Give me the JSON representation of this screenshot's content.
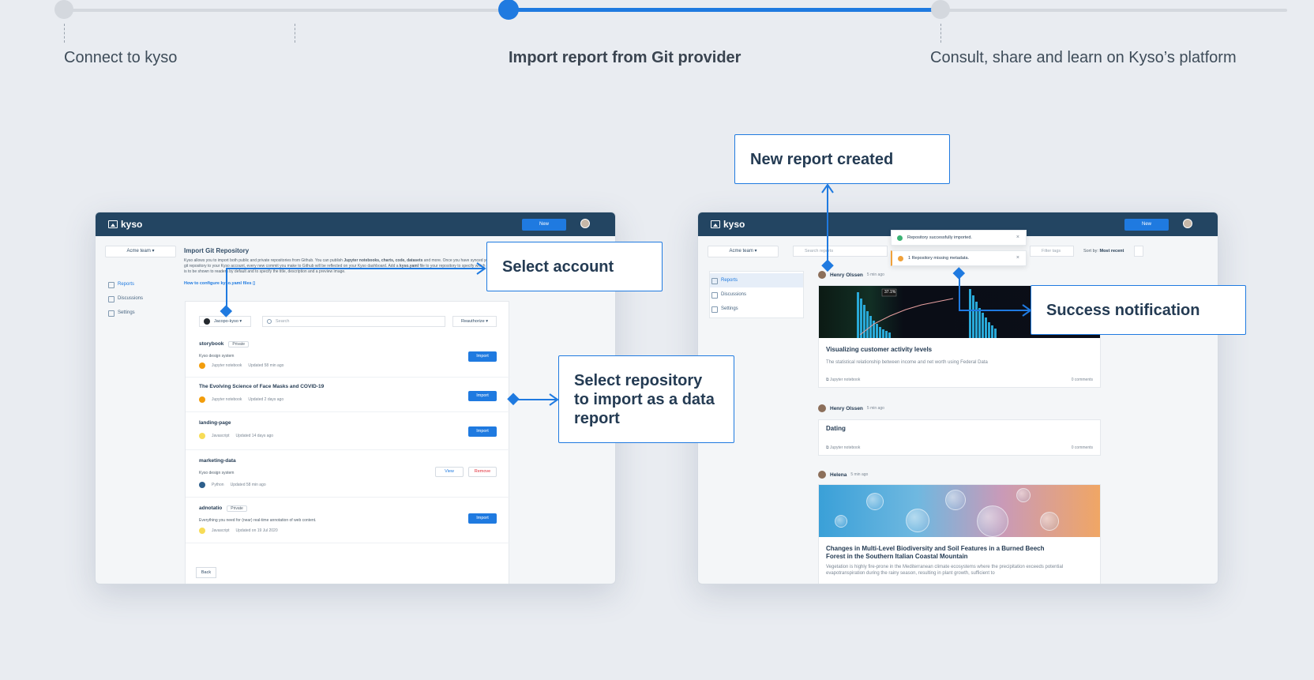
{
  "steps": [
    {
      "label": "Connect to kyso"
    },
    {
      "label": "Import report from Git provider"
    },
    {
      "label": "Consult, share and learn on Kyso’s platform"
    }
  ],
  "callouts": {
    "select_account": "Select account",
    "select_repository": "Select repository to import as a data report",
    "new_report": "New report created",
    "success_notification": "Success notification"
  },
  "left_app": {
    "logo": "kyso",
    "new_button": "New",
    "team": "Acme team",
    "nav": [
      "Reports",
      "Discussions",
      "Settings"
    ],
    "import_title": "Import Git Repository",
    "import_desc_1": "Kyso allows you to import both public and private repositories from Github.  You can publish ",
    "import_desc_bold_1": "Jupyter notebooks, charts, code, datasets",
    "import_desc_2": " and more. Once you have synced your git repository to your Kyso account, every new commit you make to Github will be reflected on your Kyso dashboard. Add a ",
    "import_desc_bold_2": "kyso.yaml",
    "import_desc_3": " file to your repository to specify which file is to be shown to readers by default and to specify the title, description and a preview image.",
    "config_link": "How to configure kyso.yaml files",
    "account": "Jacopo-kyso",
    "search_placeholder": "Search",
    "reauthorize": "Reauthorize",
    "repos": [
      {
        "name": "storybook",
        "badge": "Private",
        "sub": "Kyso design system",
        "lang": "Jupyter notebook",
        "updated": "Updated 58 min ago",
        "action": "Import",
        "dot": "#f29d0c"
      },
      {
        "name": "The Evolving Science of Face Masks and COVID-19",
        "badge": "",
        "sub": "",
        "lang": "Jupyter notebook",
        "updated": "Updated 2 days ago",
        "action": "Import",
        "dot": "#f29d0c"
      },
      {
        "name": "landing-page",
        "badge": "",
        "sub": "",
        "lang": "Javascript",
        "updated": "Updated 14 days ago",
        "action": "Import",
        "dot": "#f7dc57"
      },
      {
        "name": "marketing-data",
        "badge": "",
        "sub": "Kyso design system",
        "lang": "Python",
        "updated": "Updated 58 min ago",
        "view": "View",
        "remove": "Remove",
        "dot": "#2e5f8c"
      },
      {
        "name": "adnotatio",
        "badge": "Private",
        "sub": "Everything you need for (near) real-time annotation of web content.",
        "lang": "Javascript",
        "updated": "Updated on 19 Jul 2020",
        "action": "Import",
        "dot": "#f7dc57"
      }
    ],
    "back": "Back"
  },
  "right_app": {
    "logo": "kyso",
    "new_button": "New",
    "team": "Acme team",
    "nav": [
      "Reports",
      "Discussions",
      "Settings"
    ],
    "search_placeholder": "Search reports",
    "filter_placeholder": "Filter tags",
    "sort_label": "Sort by: ",
    "sort_value": "Most recent",
    "toast_success": "Repository successfully imported.",
    "toast_warning": "1 Repository missing metadata.",
    "chart_label": "37.1%",
    "posts": [
      {
        "author": "Henry Olssen",
        "time": "5 min ago",
        "title": "Visualizing customer activity levels",
        "desc": "The statistical relationship between income and net worth using Federal Data",
        "lang": "Jupyter notebook",
        "comments": "0 comments"
      },
      {
        "author": "Henry Olssen",
        "time": "5 min ago",
        "title": "Dating",
        "desc": "",
        "lang": "Jupyter notebook",
        "comments": "0 comments"
      },
      {
        "author": "Helena",
        "time": "5 min ago",
        "title": "Changes in Multi-Level Biodiversity and Soil Features in a Burned Beech Forest in the Southern Italian Coastal Mountain",
        "desc": "Vegetation is highly fire-prone in the Mediterranean climate ecosystems where the precipitation exceeds potential evapotranspiration during the rainy season, resulting in plant growth, sufficient to"
      }
    ]
  },
  "colors": {
    "accent": "#1f7ae0",
    "navbar": "#234562",
    "warning": "#f0a13a",
    "success": "#3bb273"
  }
}
